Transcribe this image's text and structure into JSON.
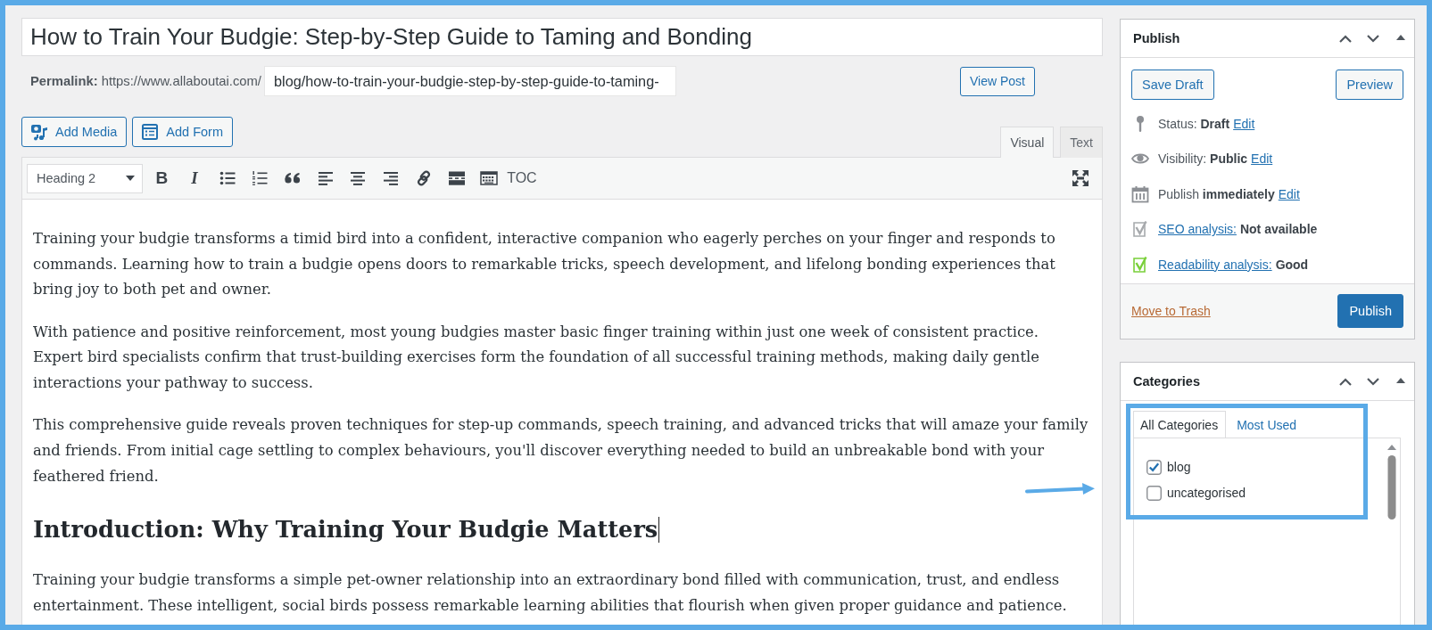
{
  "title_field": {
    "value": "How to Train Your Budgie: Step-by-Step Guide to Taming and Bonding"
  },
  "permalink": {
    "label": "Permalink:",
    "base_url": "https://www.allaboutai.com/",
    "slug": "blog/how-to-train-your-budgie-step-by-step-guide-to-taming-",
    "view_button": "View Post"
  },
  "media_buttons": [
    {
      "kind": "media",
      "label": "Add Media"
    },
    {
      "kind": "form",
      "label": "Add Form"
    }
  ],
  "editor_tabs": [
    {
      "label": "Visual",
      "selected": true
    },
    {
      "label": "Text",
      "selected": false
    }
  ],
  "toolbar": {
    "format": "Heading 2",
    "tools": [
      {
        "kind": "bold",
        "glyph": "B"
      },
      {
        "kind": "italic",
        "glyph": "I"
      },
      {
        "kind": "bullet_list"
      },
      {
        "kind": "numbered_list"
      },
      {
        "kind": "quote"
      },
      {
        "kind": "align_left"
      },
      {
        "kind": "align_center"
      },
      {
        "kind": "align_right"
      },
      {
        "kind": "link"
      },
      {
        "kind": "more"
      },
      {
        "kind": "toolbar_toggle"
      },
      {
        "kind": "toc",
        "glyph": "TOC"
      }
    ]
  },
  "content": [
    {
      "kind": "paragraph",
      "cursor": false,
      "text": "Training your budgie transforms a timid bird into a confident, interactive companion who eagerly perches on your finger and responds to commands. Learning how to train a budgie opens doors to remarkable tricks, speech development, and lifelong bonding experiences that bring joy to both pet and owner."
    },
    {
      "kind": "paragraph",
      "cursor": false,
      "text": "With patience and positive reinforcement, most young budgies master basic finger training within just one week of consistent practice. Expert bird specialists confirm that trust-building exercises form the foundation of all successful training methods, making daily gentle interactions your pathway to success."
    },
    {
      "kind": "paragraph",
      "cursor": false,
      "text": "This comprehensive guide reveals proven techniques for step-up commands, speech training, and advanced tricks that will amaze your family and friends. From initial cage settling to complex behaviours, you'll discover everything needed to build an unbreakable bond with your feathered friend."
    },
    {
      "kind": "heading",
      "cursor": true,
      "text": "Introduction: Why Training Your Budgie Matters"
    },
    {
      "kind": "paragraph",
      "cursor": false,
      "text": "Training your budgie transforms a simple pet-owner relationship into an extraordinary bond filled with communication, trust, and endless entertainment. These intelligent, social birds possess remarkable learning abilities that flourish when given proper guidance and patience."
    }
  ],
  "publish": {
    "title": "Publish",
    "save_draft": "Save Draft",
    "preview": "Preview",
    "rows": [
      {
        "kind": "status",
        "text": "Status: **Draft**",
        "link": "Edit"
      },
      {
        "kind": "visibility",
        "text": "Visibility: **Public**",
        "link": "Edit"
      },
      {
        "kind": "schedule",
        "text": "Publish **immediately**",
        "link": "Edit"
      },
      {
        "kind": "seo",
        "link": "SEO analysis:",
        "text": "Not available",
        "color": "#a7aaad"
      },
      {
        "kind": "readability",
        "link": "Readability analysis:",
        "text": "Good",
        "color": "#7ad03a"
      }
    ],
    "trash_link": "Move to Trash",
    "publish_button": "Publish"
  },
  "categories": {
    "title": "Categories",
    "tabs": [
      {
        "label": "All Categories",
        "selected": true
      },
      {
        "label": "Most Used",
        "selected": false
      }
    ],
    "items": [
      {
        "label": "blog",
        "checked": true
      },
      {
        "label": "uncategorised",
        "checked": false
      }
    ]
  }
}
